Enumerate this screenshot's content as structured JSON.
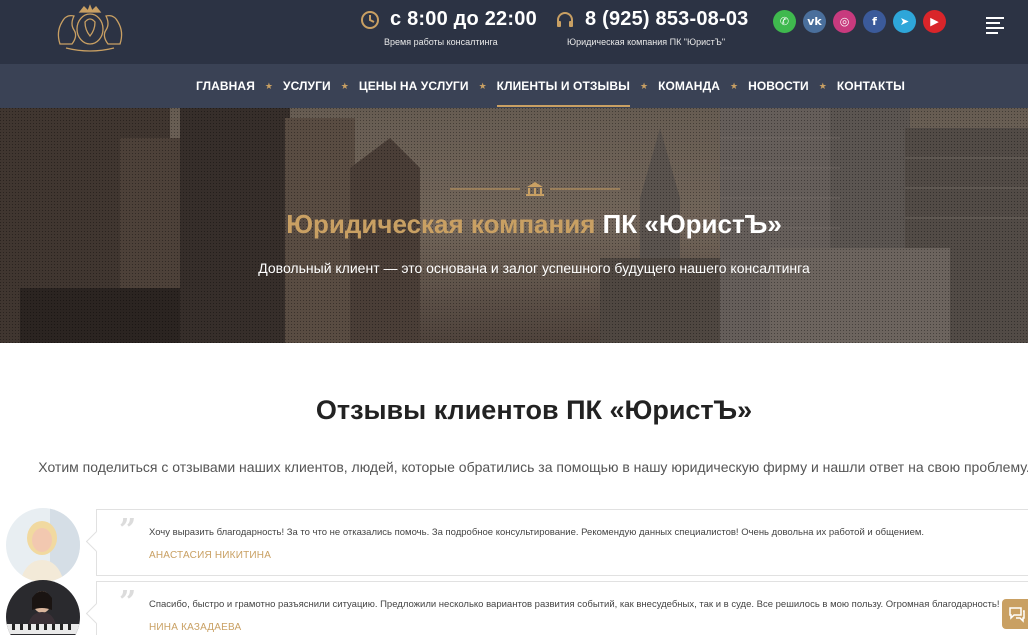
{
  "header": {
    "hours_value": "с 8:00 до 22:00",
    "hours_caption": "Время работы консалтинга",
    "phone_value": "8 (925) 853-08-03",
    "phone_caption": "Юридическая компания ПК \"ЮристЪ\"",
    "socials": [
      {
        "name": "whatsapp-icon",
        "glyph": "✆",
        "color": "#3fb94e"
      },
      {
        "name": "vk-icon",
        "glyph": "vk",
        "color": "#4a6f9c"
      },
      {
        "name": "instagram-icon",
        "glyph": "◎",
        "color": "#c83a7e"
      },
      {
        "name": "facebook-icon",
        "glyph": "f",
        "color": "#3b5a9a"
      },
      {
        "name": "telegram-icon",
        "glyph": "➤",
        "color": "#2ea6d9"
      },
      {
        "name": "youtube-icon",
        "glyph": "▶",
        "color": "#d9252a"
      }
    ]
  },
  "nav": {
    "items": [
      {
        "label": "ГЛАВНАЯ",
        "active": false
      },
      {
        "label": "УСЛУГИ",
        "active": false
      },
      {
        "label": "ЦЕНЫ НА УСЛУГИ",
        "active": false
      },
      {
        "label": "КЛИЕНТЫ И ОТЗЫВЫ",
        "active": true
      },
      {
        "label": "КОМАНДА",
        "active": false
      },
      {
        "label": "НОВОСТИ",
        "active": false
      },
      {
        "label": "КОНТАКТЫ",
        "active": false
      }
    ],
    "separator": "★"
  },
  "hero": {
    "title_gold": "Юридическая компания",
    "title_white": "ПК «ЮристЪ»",
    "subtitle": "Довольный клиент — это основана и залог успешного будущего нашего консалтинга"
  },
  "reviews_section": {
    "title": "Отзывы клиентов ПК «ЮристЪ»",
    "intro": "Хотим поделиться с отзывами наших клиентов, людей, которые обратились за помощью в нашу юридическую фирму и нашли ответ на свою проблему.",
    "quote_mark": "”",
    "reviews": [
      {
        "text": "Хочу выразить благодарность! За то что не отказались помочь. За подробное консультирование. Рекомендую данных специалистов! Очень довольна их работой и общением.",
        "author": "АНАСТАСИЯ НИКИТИНА"
      },
      {
        "text": "Спасибо, быстро и грамотно разъяснили ситуацию. Предложили несколько вариантов развития событий, как внесудебных, так и в суде. Все решилось в мою пользу. Огромная благодарность!",
        "author": "НИНА КАЗАДАЕВА"
      }
    ]
  },
  "colors": {
    "accent": "#c9a063",
    "header_bg": "#2c3344",
    "nav_bg": "#3a4255"
  }
}
